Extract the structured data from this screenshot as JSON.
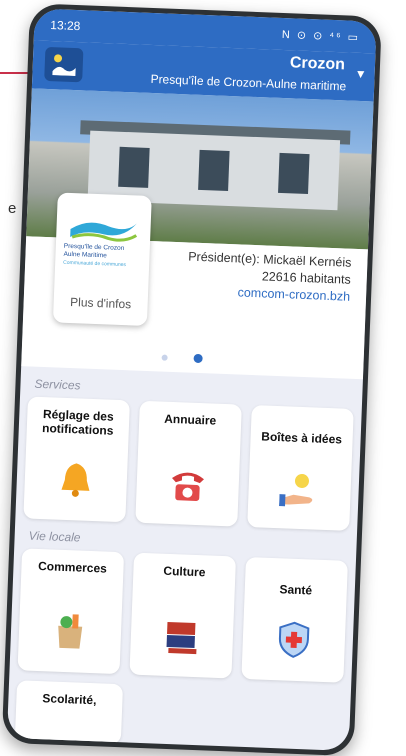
{
  "background_text": "e",
  "status_bar": {
    "time": "13:28",
    "icons": "N ⊙ ⊙ ⁴⁶ ▭"
  },
  "header": {
    "town": "Crozon",
    "region": "Presqu'île de Crozon-Aulne maritime"
  },
  "community_card": {
    "logo_lines": [
      "Presqu'île de Crozon",
      "Aulne Maritime",
      "Communauté de communes"
    ],
    "more_button": "Plus d'infos",
    "president": "Président(e): Mickaël Kernéis",
    "population": "22616 habitants",
    "website": "comcom-crozon.bzh"
  },
  "carousel": {
    "pages": 2,
    "active": 2
  },
  "services": {
    "title": "Services",
    "tiles": [
      {
        "label": "Réglage des notifications",
        "icon": "bell-icon"
      },
      {
        "label": "Annuaire",
        "icon": "telephone-icon"
      },
      {
        "label": "Boîtes à idées",
        "icon": "idea-hand-icon"
      }
    ]
  },
  "vie_locale": {
    "title": "Vie locale",
    "tiles": [
      {
        "label": "Commerces",
        "icon": "shopping-bag-icon"
      },
      {
        "label": "Culture",
        "icon": "books-icon"
      },
      {
        "label": "Santé",
        "icon": "health-shield-icon"
      },
      {
        "label": "Scolarité,",
        "icon": ""
      }
    ]
  },
  "colors": {
    "primary": "#2e6cc3",
    "accent_red": "#c9304a",
    "bell": "#f5a623"
  }
}
